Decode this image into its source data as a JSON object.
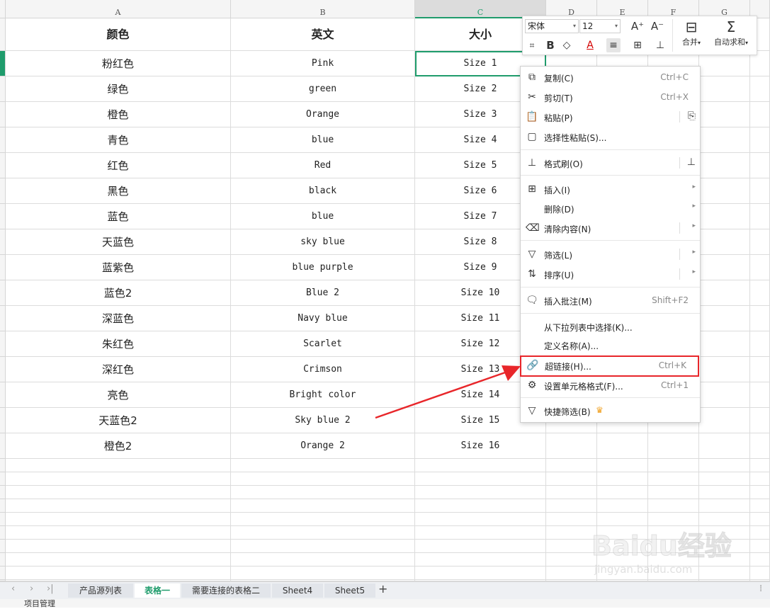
{
  "columns": [
    "A",
    "B",
    "C",
    "D",
    "E",
    "F",
    "G"
  ],
  "table": {
    "headers": [
      "颜色",
      "英文",
      "大小"
    ],
    "rows": [
      [
        "粉红色",
        "Pink",
        "Size 1"
      ],
      [
        "绿色",
        "green",
        "Size 2"
      ],
      [
        "橙色",
        "Orange",
        "Size 3"
      ],
      [
        "青色",
        "blue",
        "Size 4"
      ],
      [
        "红色",
        "Red",
        "Size 5"
      ],
      [
        "黑色",
        "black",
        "Size 6"
      ],
      [
        "蓝色",
        "blue",
        "Size 7"
      ],
      [
        "天蓝色",
        "sky blue",
        "Size 8"
      ],
      [
        "蓝紫色",
        "blue purple",
        "Size 9"
      ],
      [
        "蓝色2",
        "Blue 2",
        "Size 10"
      ],
      [
        "深蓝色",
        "Navy blue",
        "Size 11"
      ],
      [
        "朱红色",
        "Scarlet",
        "Size 12"
      ],
      [
        "深红色",
        "Crimson",
        "Size 13"
      ],
      [
        "亮色",
        "Bright color",
        "Size 14"
      ],
      [
        "天蓝色2",
        "Sky blue 2",
        "Size 15"
      ],
      [
        "橙色2",
        "Orange 2",
        "Size 16"
      ]
    ]
  },
  "toolbar": {
    "font_name": "宋体",
    "font_size": "12",
    "merge_label": "合并",
    "autosum_label": "自动求和"
  },
  "context_menu": {
    "copy": {
      "label": "复制(C)",
      "shortcut": "Ctrl+C"
    },
    "cut": {
      "label": "剪切(T)",
      "shortcut": "Ctrl+X"
    },
    "paste": {
      "label": "粘贴(P)"
    },
    "paste_special": {
      "label": "选择性粘贴(S)..."
    },
    "format_painter": {
      "label": "格式刷(O)"
    },
    "insert": {
      "label": "插入(I)"
    },
    "delete": {
      "label": "删除(D)"
    },
    "clear": {
      "label": "清除内容(N)"
    },
    "filter": {
      "label": "筛选(L)"
    },
    "sort": {
      "label": "排序(U)"
    },
    "insert_comment": {
      "label": "插入批注(M)",
      "shortcut": "Shift+F2"
    },
    "pick_from_list": {
      "label": "从下拉列表中选择(K)..."
    },
    "define_name": {
      "label": "定义名称(A)..."
    },
    "hyperlink": {
      "label": "超链接(H)...",
      "shortcut": "Ctrl+K"
    },
    "format_cells": {
      "label": "设置单元格格式(F)...",
      "shortcut": "Ctrl+1"
    },
    "quick_filter": {
      "label": "快捷筛选(B)"
    }
  },
  "sheet_tabs": [
    "产品源列表",
    "表格一",
    "需要连接的表格二",
    "Sheet4",
    "Sheet5"
  ],
  "active_sheet": "表格一",
  "status_bar": {
    "text": "项目管理"
  },
  "watermark": {
    "brand": "Baidu经验",
    "url": "jingyan.baidu.com"
  },
  "colors": {
    "accent": "#1f9c6c",
    "highlight": "#e8262a",
    "arrow": "#e8262a"
  }
}
